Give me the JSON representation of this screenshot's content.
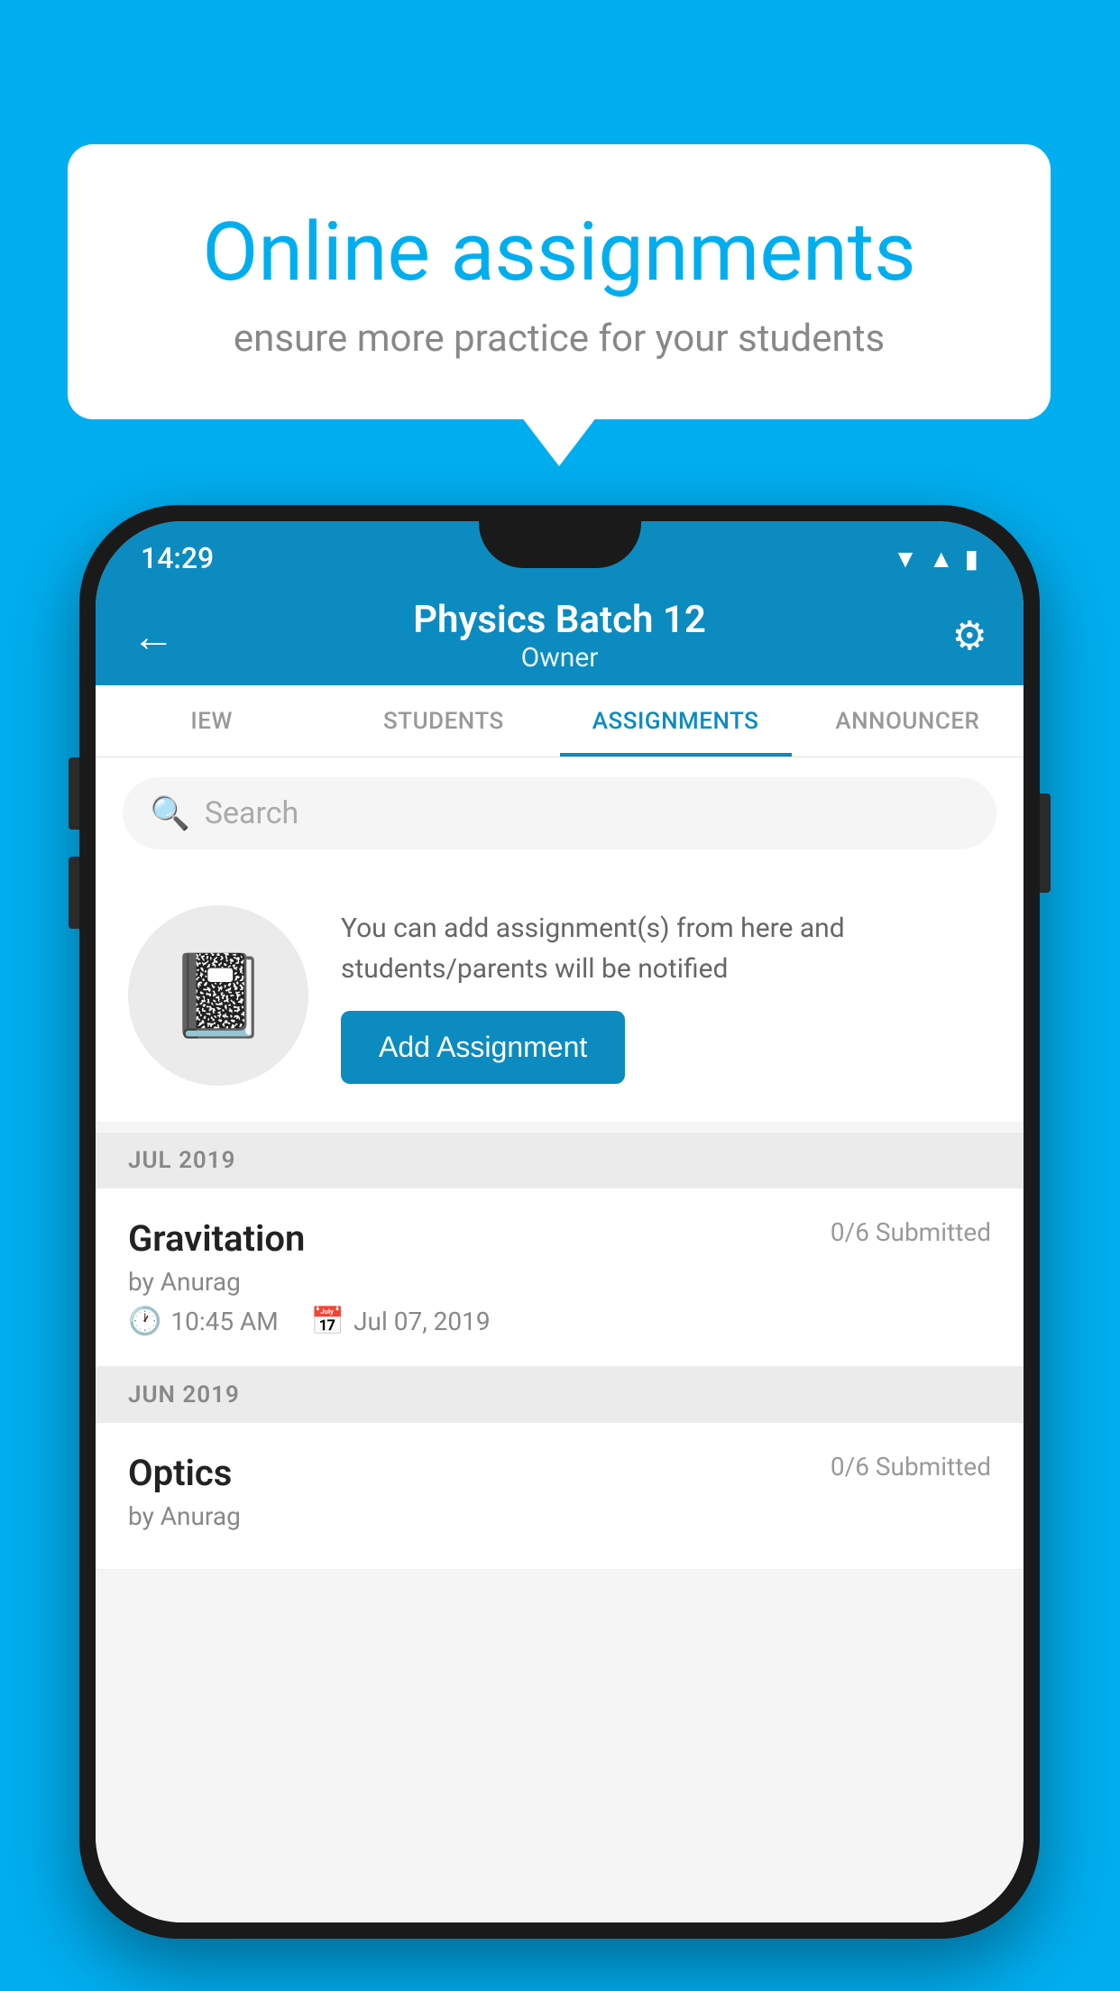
{
  "background": {
    "color": "#00AEEF"
  },
  "speech_bubble": {
    "title": "Online assignments",
    "subtitle": "ensure more practice for your students"
  },
  "status_bar": {
    "time": "14:29",
    "wifi_icon": "wifi",
    "signal_icon": "signal",
    "battery_icon": "battery"
  },
  "header": {
    "title": "Physics Batch 12",
    "subtitle": "Owner",
    "back_icon": "←",
    "settings_icon": "⚙"
  },
  "tabs": [
    {
      "label": "IEW",
      "active": false
    },
    {
      "label": "STUDENTS",
      "active": false
    },
    {
      "label": "ASSIGNMENTS",
      "active": true
    },
    {
      "label": "ANNOUNCER",
      "active": false
    }
  ],
  "search": {
    "placeholder": "Search",
    "icon": "🔍"
  },
  "promo": {
    "description": "You can add assignment(s) from here and students/parents will be notified",
    "button_label": "Add Assignment",
    "icon": "📓"
  },
  "sections": [
    {
      "month": "JUL 2019",
      "assignments": [
        {
          "title": "Gravitation",
          "submitted": "0/6 Submitted",
          "by": "by Anurag",
          "time": "10:45 AM",
          "date": "Jul 07, 2019"
        }
      ]
    },
    {
      "month": "JUN 2019",
      "assignments": [
        {
          "title": "Optics",
          "submitted": "0/6 Submitted",
          "by": "by Anurag",
          "time": "",
          "date": ""
        }
      ]
    }
  ]
}
